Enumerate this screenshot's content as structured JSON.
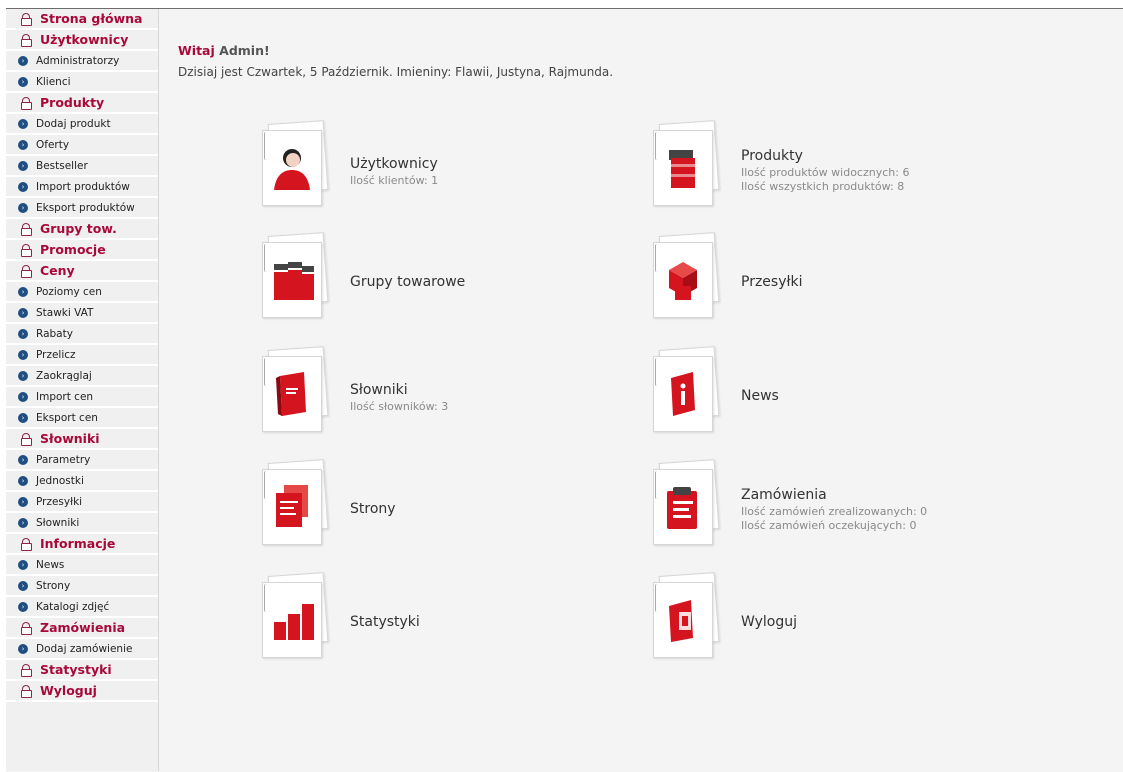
{
  "sidebar": {
    "items": [
      {
        "type": "main",
        "label": "Strona główna",
        "name": "sidebar-item-strona-glowna"
      },
      {
        "type": "main",
        "label": "Użytkownicy",
        "name": "sidebar-item-uzytkownicy"
      },
      {
        "type": "sub",
        "label": "Administratorzy",
        "name": "sidebar-item-administratorzy"
      },
      {
        "type": "sub",
        "label": "Klienci",
        "name": "sidebar-item-klienci"
      },
      {
        "type": "main",
        "label": "Produkty",
        "name": "sidebar-item-produkty"
      },
      {
        "type": "sub",
        "label": "Dodaj produkt",
        "name": "sidebar-item-dodaj-produkt"
      },
      {
        "type": "sub",
        "label": "Oferty",
        "name": "sidebar-item-oferty"
      },
      {
        "type": "sub",
        "label": "Bestseller",
        "name": "sidebar-item-bestseller"
      },
      {
        "type": "sub",
        "label": "Import produktów",
        "name": "sidebar-item-import-produktow"
      },
      {
        "type": "sub",
        "label": "Eksport produktów",
        "name": "sidebar-item-eksport-produktow"
      },
      {
        "type": "main",
        "label": "Grupy tow.",
        "name": "sidebar-item-grupy-tow"
      },
      {
        "type": "main",
        "label": "Promocje",
        "name": "sidebar-item-promocje"
      },
      {
        "type": "main",
        "label": "Ceny",
        "name": "sidebar-item-ceny"
      },
      {
        "type": "sub",
        "label": "Poziomy cen",
        "name": "sidebar-item-poziomy-cen"
      },
      {
        "type": "sub",
        "label": "Stawki VAT",
        "name": "sidebar-item-stawki-vat"
      },
      {
        "type": "sub",
        "label": "Rabaty",
        "name": "sidebar-item-rabaty"
      },
      {
        "type": "sub",
        "label": "Przelicz",
        "name": "sidebar-item-przelicz"
      },
      {
        "type": "sub",
        "label": "Zaokrąglaj",
        "name": "sidebar-item-zaokraglaj"
      },
      {
        "type": "sub",
        "label": "Import cen",
        "name": "sidebar-item-import-cen"
      },
      {
        "type": "sub",
        "label": "Eksport cen",
        "name": "sidebar-item-eksport-cen"
      },
      {
        "type": "main",
        "label": "Słowniki",
        "name": "sidebar-item-slowniki"
      },
      {
        "type": "sub",
        "label": "Parametry",
        "name": "sidebar-item-parametry"
      },
      {
        "type": "sub",
        "label": "Jednostki",
        "name": "sidebar-item-jednostki"
      },
      {
        "type": "sub",
        "label": "Przesyłki",
        "name": "sidebar-item-przesylki"
      },
      {
        "type": "sub",
        "label": "Słowniki",
        "name": "sidebar-item-slowniki-sub"
      },
      {
        "type": "main",
        "label": "Informacje",
        "name": "sidebar-item-informacje"
      },
      {
        "type": "sub",
        "label": "News",
        "name": "sidebar-item-news"
      },
      {
        "type": "sub",
        "label": "Strony",
        "name": "sidebar-item-strony"
      },
      {
        "type": "sub",
        "label": "Katalogi zdjęć",
        "name": "sidebar-item-katalogi-zdjec"
      },
      {
        "type": "main",
        "label": "Zamówienia",
        "name": "sidebar-item-zamowienia"
      },
      {
        "type": "sub",
        "label": "Dodaj zamówienie",
        "name": "sidebar-item-dodaj-zamowienie"
      },
      {
        "type": "main",
        "label": "Statystyki",
        "name": "sidebar-item-statystyki"
      },
      {
        "type": "main",
        "label": "Wyloguj",
        "name": "sidebar-item-wyloguj"
      }
    ]
  },
  "header": {
    "greeting_word": "Witaj",
    "user": "Admin!",
    "date_line": "Dzisiaj jest Czwartek, 5 Październik. Imieniny: Flawii, Justyna, Rajmunda."
  },
  "tiles": [
    {
      "name": "tile-uzytkownicy",
      "icon": "user-icon",
      "title": "Użytkownicy",
      "lines": [
        "Ilość klientów: 1"
      ]
    },
    {
      "name": "tile-produkty",
      "icon": "products-icon",
      "title": "Produkty",
      "lines": [
        "Ilość produktów widocznych: 6",
        "Ilość wszystkich produktów: 8"
      ]
    },
    {
      "name": "tile-grupy-towarowe",
      "icon": "product-groups-icon",
      "title": "Grupy towarowe",
      "lines": []
    },
    {
      "name": "tile-przesylki",
      "icon": "packages-icon",
      "title": "Przesyłki",
      "lines": []
    },
    {
      "name": "tile-slowniki",
      "icon": "dictionary-icon",
      "title": "Słowniki",
      "lines": [
        "Ilość słowników: 3"
      ]
    },
    {
      "name": "tile-news",
      "icon": "news-icon",
      "title": "News",
      "lines": []
    },
    {
      "name": "tile-strony",
      "icon": "pages-icon",
      "title": "Strony",
      "lines": []
    },
    {
      "name": "tile-zamowienia",
      "icon": "orders-icon",
      "title": "Zamówienia",
      "lines": [
        "Ilość zamówień zrealizowanych: 0",
        "Ilość zamówień oczekujących: 0"
      ]
    },
    {
      "name": "tile-statystyki",
      "icon": "statistics-icon",
      "title": "Statystyki",
      "lines": []
    },
    {
      "name": "tile-wyloguj",
      "icon": "logout-icon",
      "title": "Wyloguj",
      "lines": []
    }
  ],
  "colors": {
    "accent": "#a8093a",
    "icon_red": "#d4141e",
    "bullet": "#1f4f82"
  }
}
